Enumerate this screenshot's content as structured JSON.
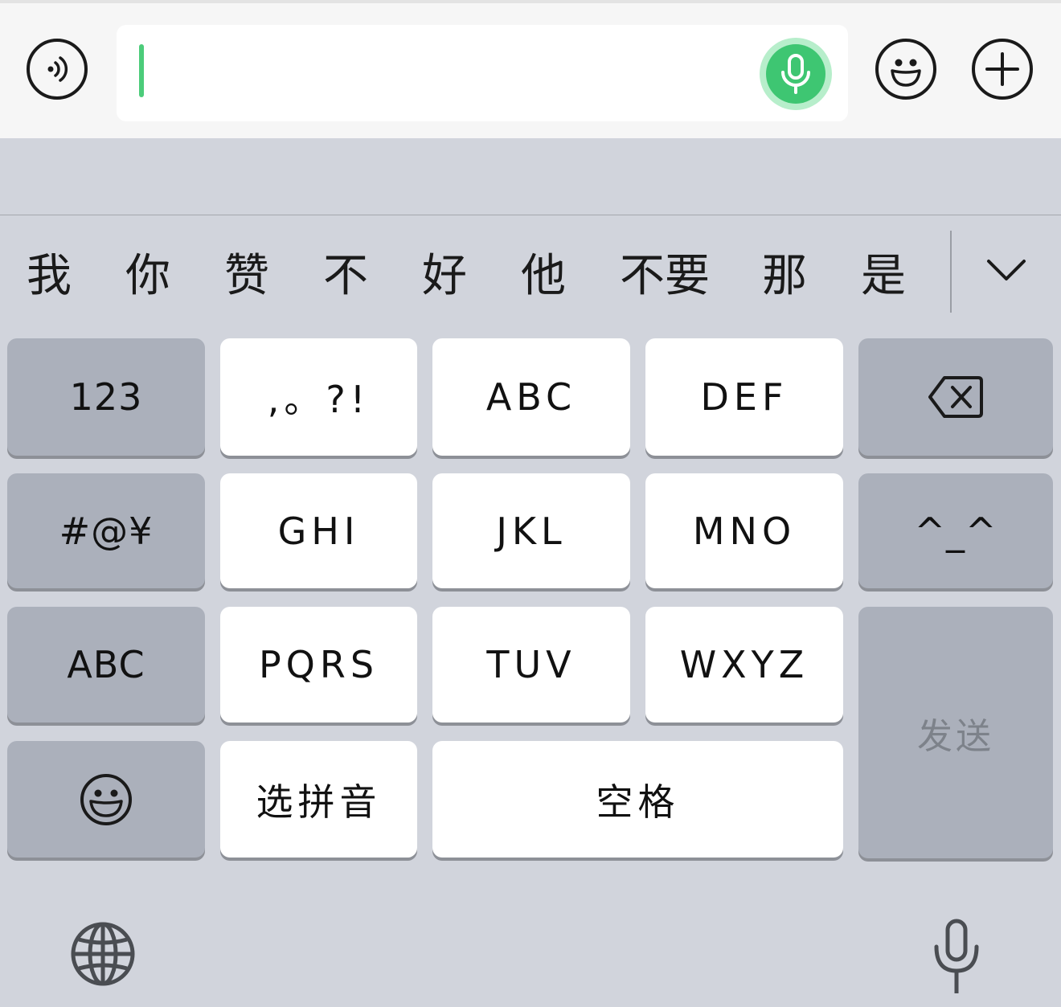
{
  "input": {
    "value": ""
  },
  "icons": {
    "voice": "voice-message-icon",
    "mic": "microphone-icon",
    "emoji": "emoji-icon",
    "plus": "plus-icon",
    "backspace": "backspace-icon",
    "expand": "chevron-down-icon",
    "globe": "globe-icon",
    "dictation": "dictation-mic-icon"
  },
  "candidates": [
    "我",
    "你",
    "赞",
    "不",
    "好",
    "他",
    "不要",
    "那",
    "是"
  ],
  "keys": {
    "row1": [
      "123",
      ",。?!",
      "ABC",
      "DEF"
    ],
    "row2": [
      "#@¥",
      "GHI",
      "JKL",
      "MNO",
      "^_^"
    ],
    "row3": [
      "ABC",
      "PQRS",
      "TUV",
      "WXYZ"
    ],
    "row4": [
      "选拼音",
      "空格"
    ],
    "send": "发送"
  },
  "colors": {
    "accent_green": "#3ec672",
    "keyboard_bg": "#d1d4dc",
    "key_light": "#ffffff",
    "key_dark": "#abb0bb"
  }
}
